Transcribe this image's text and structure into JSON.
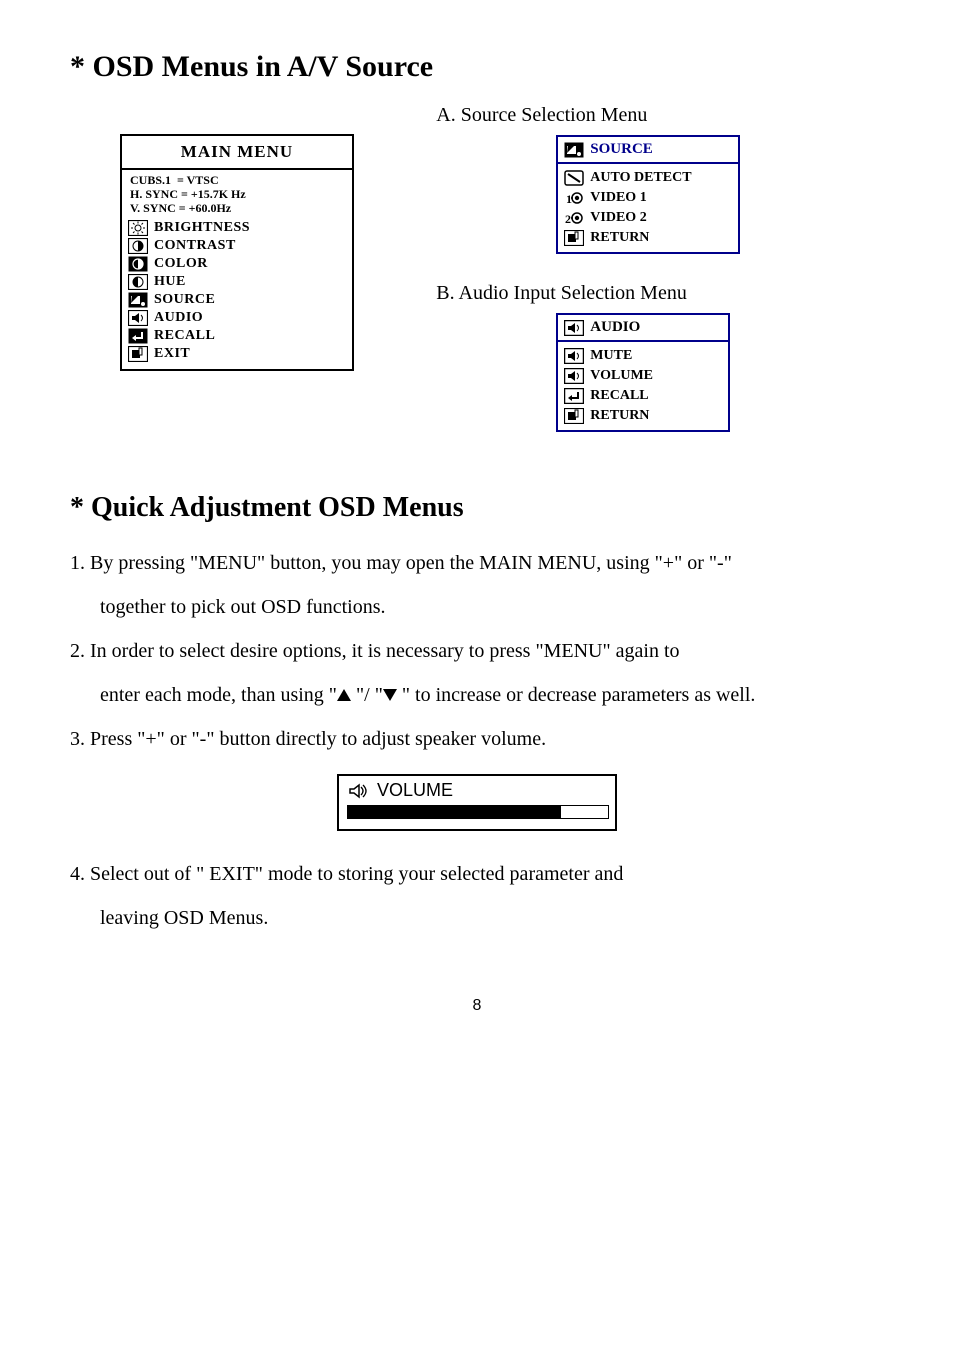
{
  "headings": {
    "section1": "* OSD Menus in A/V Source",
    "section2": "* Quick Adjustment OSD Menus"
  },
  "main_menu": {
    "title": "MAIN MENU",
    "info_line1_left": "CUBS.1",
    "info_line1_right": "=  VTSC",
    "info_line2_left": "H. SYNC",
    "info_line2_right": "=  +15.7K Hz",
    "info_line3_left": "V. SYNC",
    "info_line3_right": "=   +60.0Hz",
    "items": {
      "brightness": "BRIGHTNESS",
      "contrast": "CONTRAST",
      "color": "COLOR",
      "hue": "HUE",
      "source": "SOURCE",
      "audio": "AUDIO",
      "recall": "RECALL",
      "exit": "EXIT"
    }
  },
  "submenu_a": {
    "caption": "A. Source Selection Menu",
    "title": "SOURCE",
    "items": {
      "auto_detect": "AUTO DETECT",
      "video1": "VIDEO 1",
      "video2": "VIDEO 2",
      "return": "RETURN"
    }
  },
  "submenu_b": {
    "caption": "B. Audio Input Selection Menu",
    "title": "AUDIO",
    "items": {
      "mute": "MUTE",
      "volume": "VOLUME",
      "recall": "RECALL",
      "return": "RETURN"
    }
  },
  "instructions": {
    "line1a": "1. By pressing \"MENU\" button, you may open the MAIN MENU, using \"+\" or \"-\"",
    "line1b": "together to pick out OSD functions.",
    "line2a": "2. In order to select desire options, it is necessary to press \"MENU\" again to",
    "line2b_pre": "enter each mode, than using \"",
    "line2b_mid": " \"/ \"",
    "line2b_post": " \" to increase or decrease parameters as well.",
    "line3": "3. Press \"+\" or \"-\" button directly to adjust speaker volume.",
    "line4a": "4. Select out of \" EXIT\" mode to storing your selected parameter and",
    "line4b": "leaving  OSD Menus."
  },
  "volume_widget": {
    "label": "VOLUME"
  },
  "page_number": "8"
}
